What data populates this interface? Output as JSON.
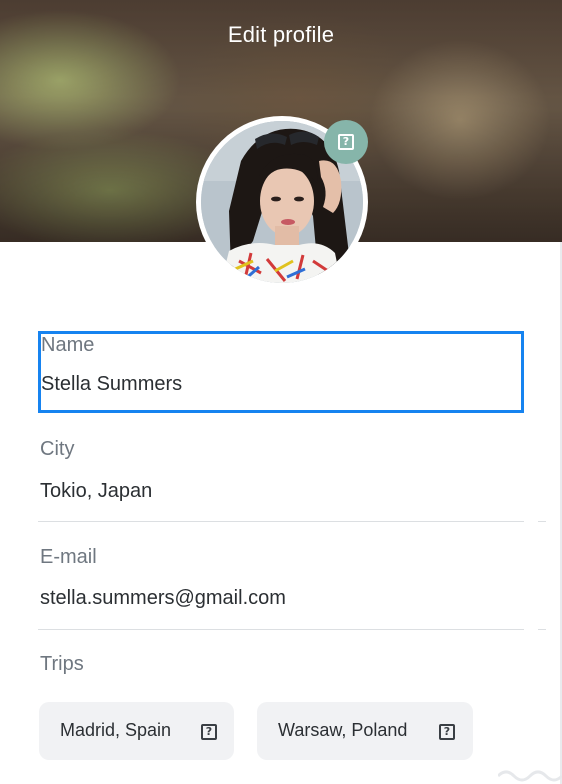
{
  "header": {
    "title": "Edit profile"
  },
  "avatar": {
    "alt": "Profile photo",
    "camera_icon": "question-box-icon"
  },
  "fields": {
    "name": {
      "label": "Name",
      "value": "Stella Summers",
      "focused": true
    },
    "city": {
      "label": "City",
      "value": "Tokio, Japan"
    },
    "email": {
      "label": "E-mail",
      "value": "stella.summers@gmail.com"
    }
  },
  "trips": {
    "label": "Trips",
    "items": [
      {
        "label": "Madrid, Spain",
        "icon": "question-box-icon"
      },
      {
        "label": "Warsaw, Poland",
        "icon": "question-box-icon"
      }
    ]
  },
  "colors": {
    "accent_focus": "#1683f0",
    "camera_button": "#86b5aa",
    "chip_bg": "#f1f2f4",
    "label_text": "#6f7780",
    "value_text": "#2b2f33"
  }
}
